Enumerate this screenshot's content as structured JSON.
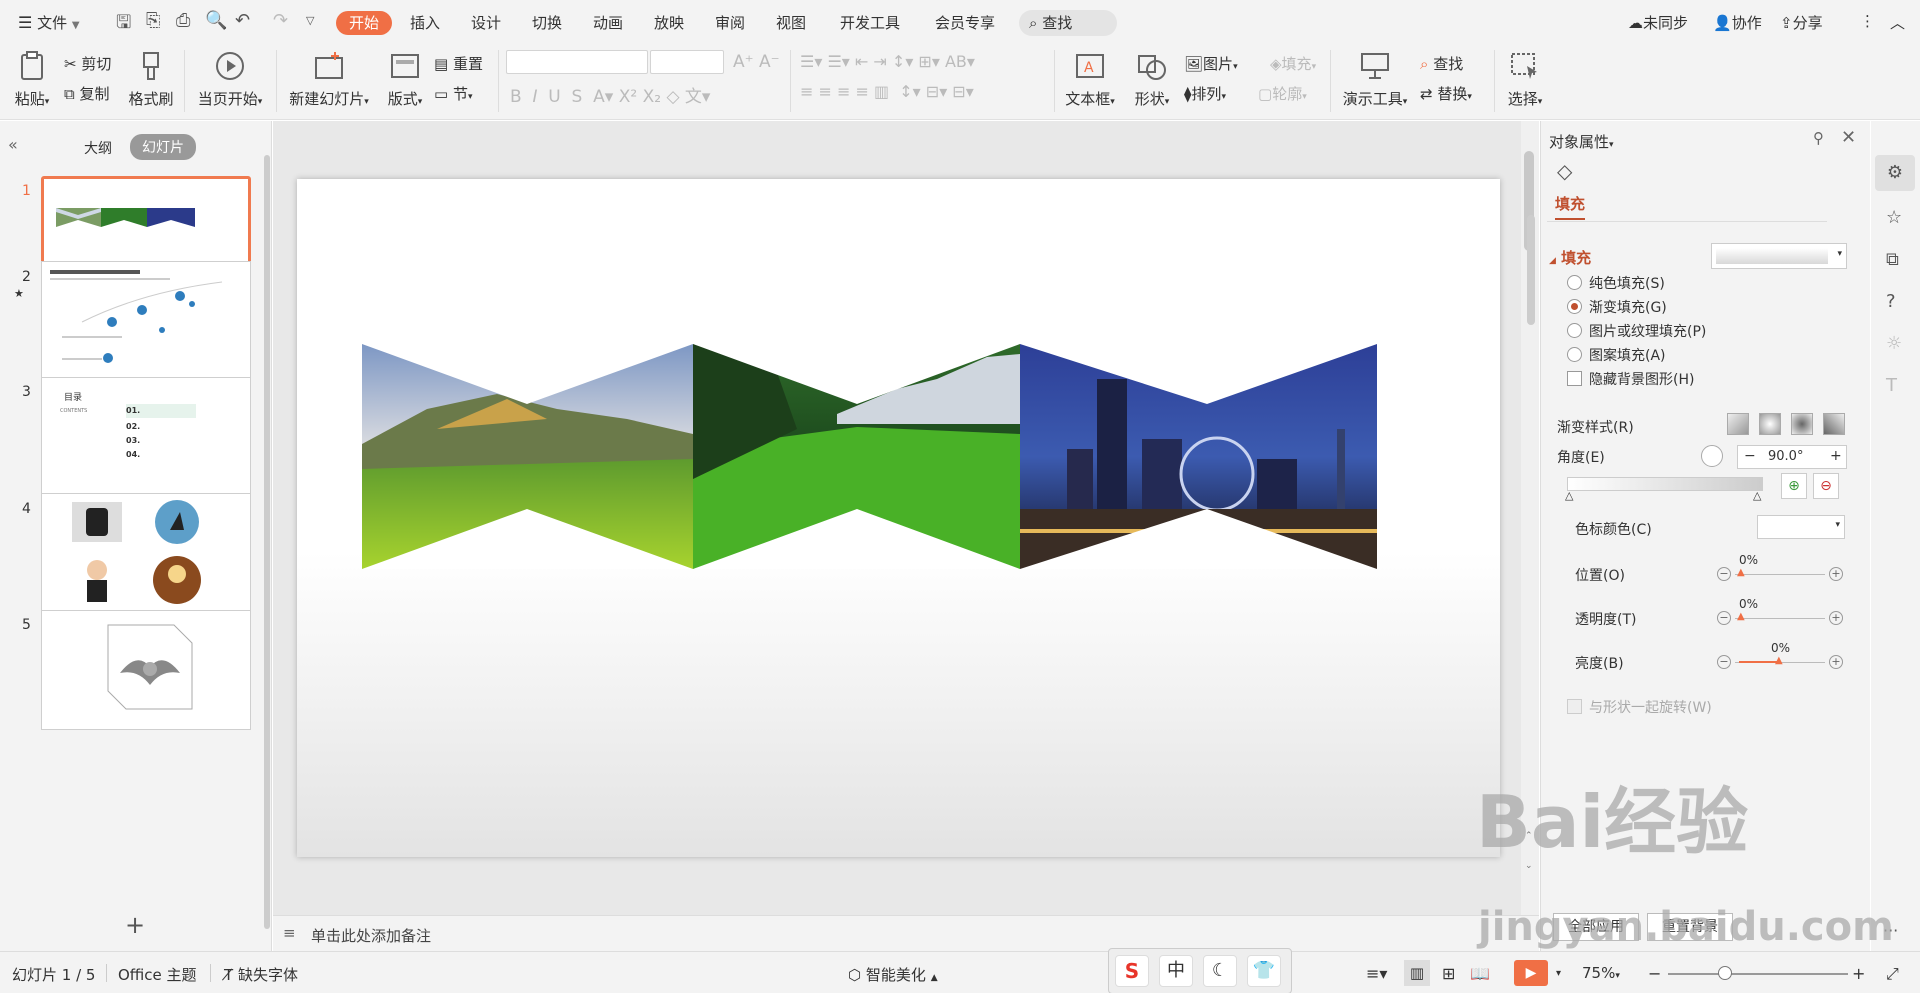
{
  "titlebar": {
    "file_menu": "文件",
    "tabs": [
      "开始",
      "插入",
      "设计",
      "切换",
      "动画",
      "放映",
      "审阅",
      "视图",
      "开发工具",
      "会员专享"
    ],
    "active_tab": "开始",
    "search": "查找",
    "sync": "未同步",
    "collab": "协作",
    "share": "分享"
  },
  "ribbon": {
    "paste": "粘贴",
    "cut": "剪切",
    "copy": "复制",
    "format_painter": "格式刷",
    "play_from_current": "当页开始",
    "new_slide": "新建幻灯片",
    "layout": "版式",
    "reset": "重置",
    "section": "节",
    "textbox": "文本框",
    "shape": "形状",
    "picture": "图片",
    "fill": "填充",
    "arrange": "排列",
    "outline": "轮廓",
    "presenter_tools": "演示工具",
    "find": "查找",
    "replace": "替换",
    "select": "选择"
  },
  "leftpanel": {
    "tab_outline": "大纲",
    "tab_slides": "幻灯片",
    "slide_numbers": [
      "1",
      "2",
      "3",
      "4",
      "5"
    ],
    "selected_slide": 1,
    "slide3_title": "目录",
    "slide3_sub": "CONTENTS",
    "slide3_items": [
      "01.",
      "02.",
      "03.",
      "04."
    ]
  },
  "rightpanel": {
    "title": "对象属性",
    "tab_fill": "填充",
    "section_fill": "填充",
    "options": [
      "纯色填充(S)",
      "渐变填充(G)",
      "图片或纹理填充(P)",
      "图案填充(A)"
    ],
    "selected_option": "渐变填充(G)",
    "hide_bg": "隐藏背景图形(H)",
    "gradient_style": "渐变样式(R)",
    "angle_label": "角度(E)",
    "angle_value": "90.0°",
    "stop_color": "色标颜色(C)",
    "position_label": "位置(O)",
    "position_value": "0%",
    "transparency_label": "透明度(T)",
    "transparency_value": "0%",
    "brightness_label": "亮度(B)",
    "brightness_value": "0%",
    "rotate_with_shape": "与形状一起旋转(W)",
    "apply_all": "全部应用",
    "reset_bg": "重置背景"
  },
  "notes_placeholder": "单击此处添加备注",
  "statusbar": {
    "slide_info": "幻灯片 1 / 5",
    "theme": "Office 主题",
    "missing_font": "缺失字体",
    "smart_beautify": "智能美化",
    "zoom": "75%"
  },
  "ime": {
    "mode": "中"
  },
  "watermark": {
    "brand": "Bai经验",
    "url": "jingyan.baidu.com"
  },
  "colors": {
    "accent": "#f06f45",
    "panel_bg": "#f3f3f3",
    "selected_border": "#f07a4f"
  }
}
